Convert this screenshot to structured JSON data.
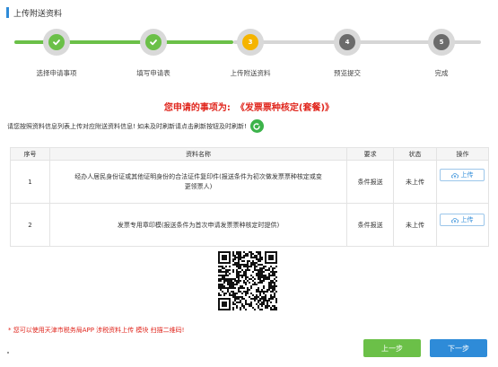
{
  "page": {
    "title": "上传附送资料"
  },
  "steps": [
    {
      "number": "1",
      "label": "选择申请事项",
      "status": "done"
    },
    {
      "number": "2",
      "label": "填写申请表",
      "status": "done"
    },
    {
      "number": "3",
      "label": "上传附送资料",
      "status": "current"
    },
    {
      "number": "4",
      "label": "预览提交",
      "status": "todo"
    },
    {
      "number": "5",
      "label": "完成",
      "status": "todo"
    }
  ],
  "headline": {
    "prefix": "您申请的事项为:",
    "item": "《发票票种核定(套餐)》"
  },
  "notice": {
    "text": "请您按照资料信息列表上传对应附送资料信息! 如未及时刷新请点击刷新按钮及时刷新!"
  },
  "table": {
    "headers": [
      "序号",
      "资料名称",
      "要求",
      "状态",
      "操作"
    ],
    "rows": [
      {
        "index": "1",
        "name": "经办人居民身份证或其他证明身份的合法证件复印件(报送条件为初次做发票票种核定或变更领票人)",
        "requirement": "条件报送",
        "status": "未上传",
        "action": "上传"
      },
      {
        "index": "2",
        "name": "发票专用章印模(报送条件为首次申请发票票种核定时提供)",
        "requirement": "条件报送",
        "status": "未上传",
        "action": "上传"
      }
    ]
  },
  "hint": "* 您可以使用天津市税务局APP 涉税资料上传 模块 扫描二维码!",
  "buttons": {
    "prev": "上一步",
    "next": "下一步"
  },
  "colors": {
    "accent": "#2e8bd8",
    "done": "#6bc048",
    "current": "#f5b400",
    "todo": "#6b6b6b",
    "alert": "#e0251c"
  }
}
